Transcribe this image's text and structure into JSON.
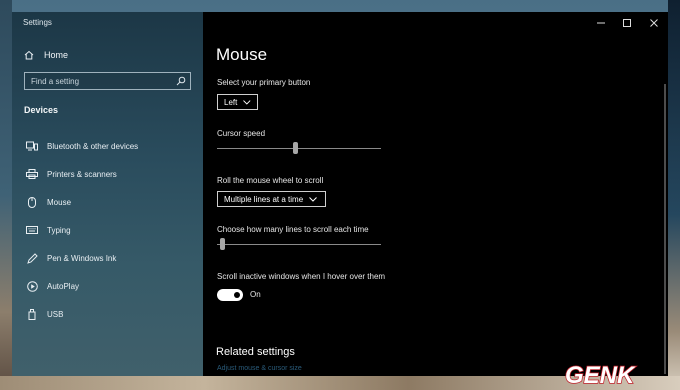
{
  "window": {
    "title": "Settings"
  },
  "titlebar": {
    "minimize_icon": "minimize-icon",
    "maximize_icon": "maximize-icon",
    "close_icon": "close-icon"
  },
  "sidebar": {
    "home_label": "Home",
    "search_placeholder": "Find a setting",
    "section_title": "Devices",
    "items": [
      {
        "label": "Bluetooth & other devices",
        "icon": "bluetooth-devices-icon"
      },
      {
        "label": "Printers & scanners",
        "icon": "printer-icon"
      },
      {
        "label": "Mouse",
        "icon": "mouse-icon"
      },
      {
        "label": "Typing",
        "icon": "keyboard-icon"
      },
      {
        "label": "Pen & Windows Ink",
        "icon": "pen-icon"
      },
      {
        "label": "AutoPlay",
        "icon": "autoplay-icon"
      },
      {
        "label": "USB",
        "icon": "usb-icon"
      }
    ]
  },
  "main": {
    "title": "Mouse",
    "primary_button": {
      "label": "Select your primary button",
      "value": "Left"
    },
    "cursor_speed": {
      "label": "Cursor speed",
      "level": 0.48
    },
    "scroll_mode": {
      "label": "Roll the mouse wheel to scroll",
      "value": "Multiple lines at a time"
    },
    "scroll_lines": {
      "label": "Choose how many lines to scroll each time",
      "level": 0.02
    },
    "inactive_scroll": {
      "label": "Scroll inactive windows when I hover over them",
      "state": "On"
    },
    "related_title": "Related settings",
    "related_link": "Adjust mouse & cursor size"
  },
  "watermark": {
    "text": "GENK"
  },
  "colors": {
    "sidebar": "#2a4c5d",
    "content_bg": "#000000",
    "link": "#2a5b7a",
    "toggle_on": "#ffffff"
  }
}
